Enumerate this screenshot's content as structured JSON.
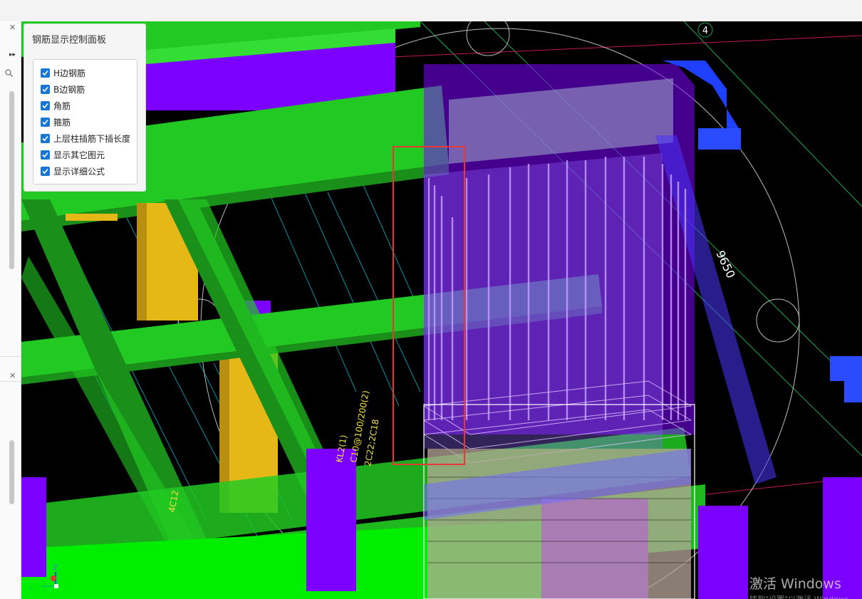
{
  "panel": {
    "title": "钢筋显示控制面板",
    "options": [
      {
        "label": "H边钢筋",
        "checked": true
      },
      {
        "label": "B边钢筋",
        "checked": true
      },
      {
        "label": "角筋",
        "checked": true
      },
      {
        "label": "箍筋",
        "checked": true
      },
      {
        "label": "上层柱插筋下插长度",
        "checked": true
      },
      {
        "label": "显示其它图元",
        "checked": true
      },
      {
        "label": "显示详细公式",
        "checked": true
      }
    ]
  },
  "viewport": {
    "axis_number": "4",
    "dimension_label": "9650",
    "beam_labels": [
      "KL2(1)",
      "C10@100/200(2)",
      "2C22;2C18",
      "4C12"
    ],
    "axis_letters": {
      "z": "Z",
      "y": "Y"
    }
  },
  "watermark": {
    "line1": "激活 Windows",
    "line2": "转到\"设置\"以激活 Windows。"
  },
  "colors": {
    "beam_green": "#2ecc2e",
    "beam_dark_green": "#1a8f1a",
    "column_purple": "#7b00ff",
    "column_yellow": "#e6b817",
    "highlight_red": "#e53935",
    "rebar_violet": "#b07cff"
  }
}
